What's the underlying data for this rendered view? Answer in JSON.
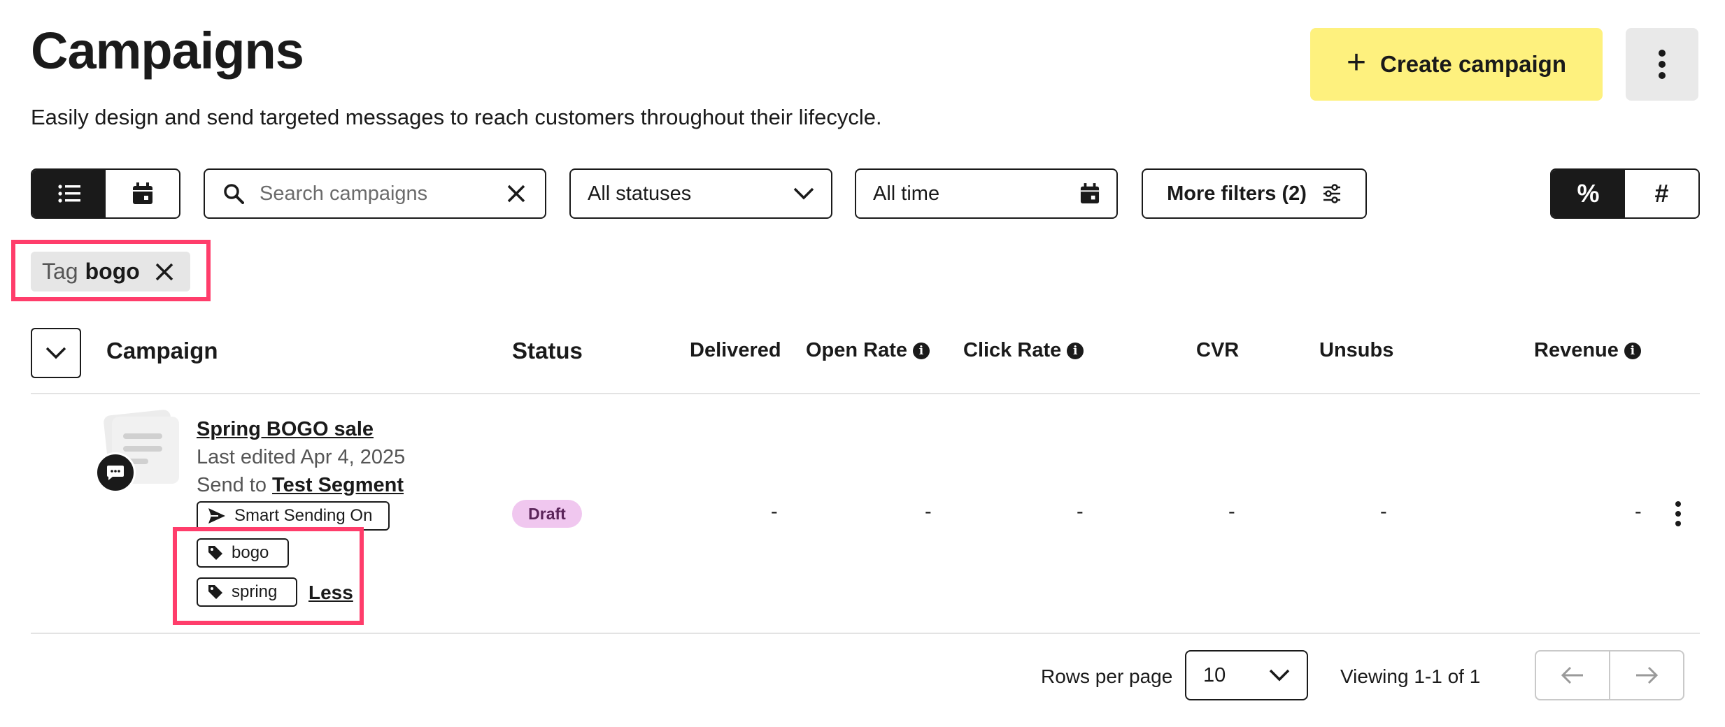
{
  "header": {
    "title": "Campaigns",
    "subtitle": "Easily design and send targeted messages to reach customers throughout their lifecycle.",
    "create_label": "Create campaign"
  },
  "toolbar": {
    "search_placeholder": "Search campaigns",
    "status_filter": "All statuses",
    "time_filter": "All time",
    "more_filters_label": "More filters (2)",
    "metric_percent": "%",
    "metric_count": "#"
  },
  "active_filter": {
    "key": "Tag",
    "value": "bogo"
  },
  "table": {
    "columns": [
      "Campaign",
      "Status",
      "Delivered",
      "Open Rate",
      "Click Rate",
      "CVR",
      "Unsubs",
      "Revenue"
    ],
    "rows": [
      {
        "name": "Spring BOGO sale",
        "meta": "Last edited Apr 4, 2025",
        "send_prefix": "Send to",
        "segment": "Test Segment",
        "smart_sending": "Smart Sending On",
        "tags": [
          "bogo",
          "spring"
        ],
        "less_label": "Less",
        "status": "Draft",
        "delivered": "-",
        "open_rate": "-",
        "click_rate": "-",
        "cvr": "-",
        "unsubs": "-",
        "revenue": "-"
      }
    ]
  },
  "pagination": {
    "rows_label": "Rows per page",
    "rows_value": "10",
    "viewing": "Viewing 1-1 of 1"
  },
  "colors": {
    "accent_yellow": "#fef17e",
    "highlight": "#ff3d6b",
    "draft_badge": "#f0c7ef",
    "dark": "#1a1a1a"
  }
}
